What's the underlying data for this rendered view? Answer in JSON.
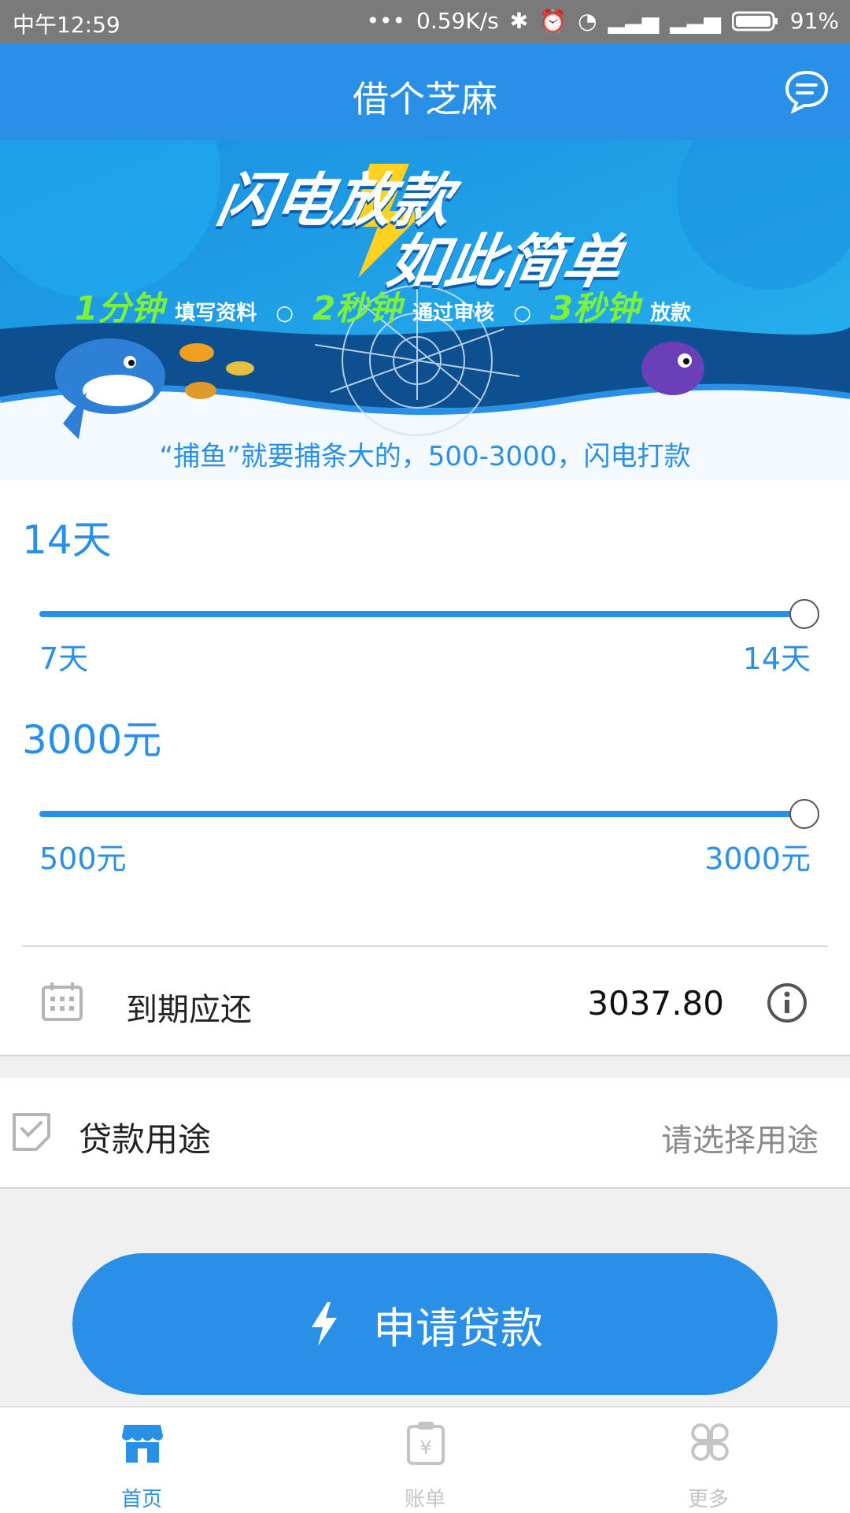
{
  "status_bar": {
    "time": "中午12:59",
    "speed": "0.59K/s",
    "battery": "91%"
  },
  "header": {
    "title": "借个芝麻",
    "message_icon": "chat-bubble-icon"
  },
  "banner": {
    "headline_line1": "闪电放款",
    "headline_line2": "如此简单",
    "steps": [
      {
        "num": "1分钟",
        "text": "填写资料"
      },
      {
        "num": "2秒钟",
        "text": "通过审核"
      },
      {
        "num": "3秒钟",
        "text": "放款"
      }
    ],
    "separator": "○",
    "tagline": "“捕鱼”就要捕条大的，500-3000，闪电打款"
  },
  "term_slider": {
    "value_label": "14天",
    "min_label": "7天",
    "max_label": "14天",
    "value_fraction": 1.0
  },
  "amount_slider": {
    "value_label": "3000元",
    "min_label": "500元",
    "max_label": "3000元",
    "value_fraction": 1.0
  },
  "repayment": {
    "label": "到期应还",
    "amount": "3037.80",
    "info_icon": "info-icon",
    "calendar_icon": "calendar-icon"
  },
  "purpose": {
    "label": "贷款用途",
    "placeholder": "请选择用途",
    "icon": "checklist-icon"
  },
  "apply_button": {
    "label": "申请贷款",
    "icon": "lightning-icon"
  },
  "tabbar": {
    "items": [
      {
        "label": "首页",
        "icon": "store-icon",
        "active": true
      },
      {
        "label": "账单",
        "icon": "bill-icon",
        "active": false
      },
      {
        "label": "更多",
        "icon": "more-icon",
        "active": false
      }
    ]
  },
  "colors": {
    "primary": "#2a8fe6",
    "inactive": "#c4c4c4",
    "step_green": "#7df03a"
  }
}
